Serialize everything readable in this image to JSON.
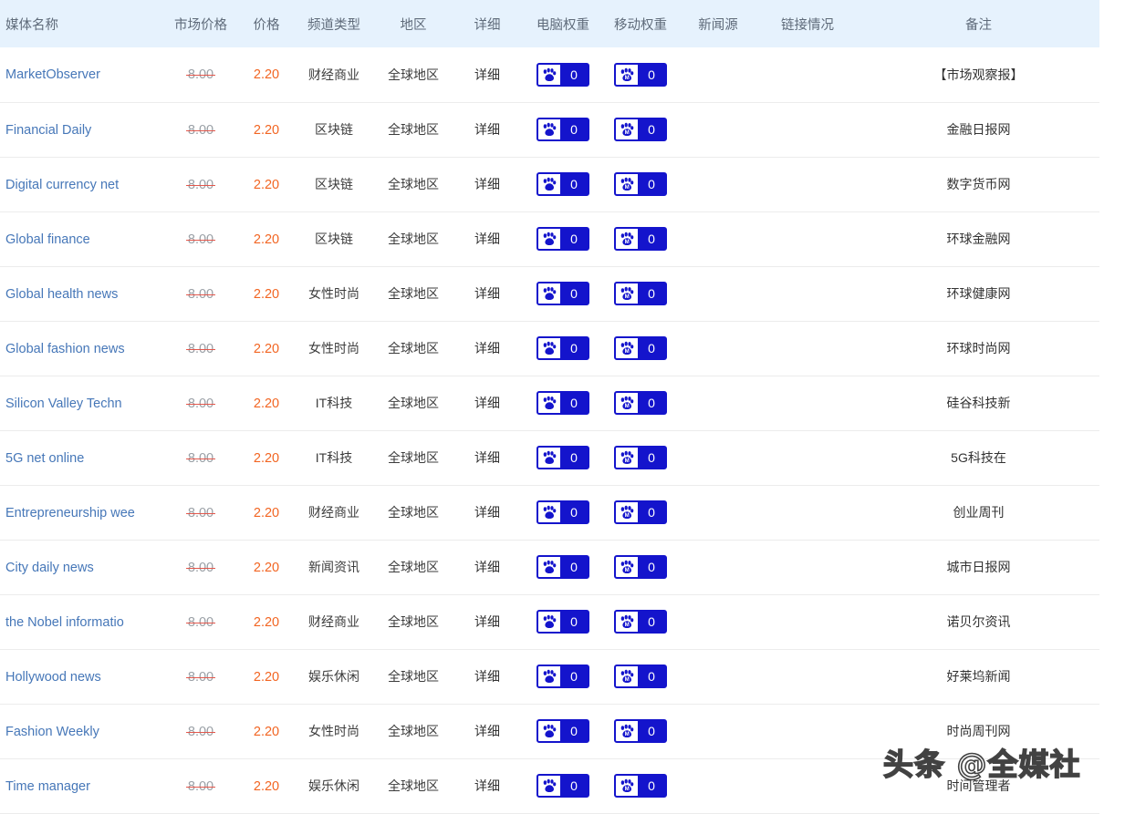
{
  "table": {
    "columns": [
      {
        "key": "name",
        "label": "媒体名称"
      },
      {
        "key": "market",
        "label": "市场价格"
      },
      {
        "key": "price",
        "label": "价格"
      },
      {
        "key": "channel",
        "label": "频道类型"
      },
      {
        "key": "region",
        "label": "地区"
      },
      {
        "key": "detail",
        "label": "详细"
      },
      {
        "key": "pc",
        "label": "电脑权重"
      },
      {
        "key": "mobile",
        "label": "移动权重"
      },
      {
        "key": "news",
        "label": "新闻源"
      },
      {
        "key": "link",
        "label": "链接情况"
      },
      {
        "key": "note",
        "label": "备注"
      }
    ],
    "detail_label": "详细",
    "rows": [
      {
        "name": "MarketObserver",
        "market": "8.00",
        "price": "2.20",
        "channel": "财经商业",
        "region": "全球地区",
        "detail": "详细",
        "pc": "0",
        "mobile": "0",
        "news": "",
        "link": "",
        "note": "【市场观察报】"
      },
      {
        "name": "Financial Daily",
        "market": "8.00",
        "price": "2.20",
        "channel": "区块链",
        "region": "全球地区",
        "detail": "详细",
        "pc": "0",
        "mobile": "0",
        "news": "",
        "link": "",
        "note": "金融日报网"
      },
      {
        "name": "Digital currency net",
        "market": "8.00",
        "price": "2.20",
        "channel": "区块链",
        "region": "全球地区",
        "detail": "详细",
        "pc": "0",
        "mobile": "0",
        "news": "",
        "link": "",
        "note": "数字货币网"
      },
      {
        "name": "Global finance",
        "market": "8.00",
        "price": "2.20",
        "channel": "区块链",
        "region": "全球地区",
        "detail": "详细",
        "pc": "0",
        "mobile": "0",
        "news": "",
        "link": "",
        "note": "环球金融网"
      },
      {
        "name": "Global health news",
        "market": "8.00",
        "price": "2.20",
        "channel": "女性时尚",
        "region": "全球地区",
        "detail": "详细",
        "pc": "0",
        "mobile": "0",
        "news": "",
        "link": "",
        "note": "环球健康网"
      },
      {
        "name": "Global fashion news",
        "market": "8.00",
        "price": "2.20",
        "channel": "女性时尚",
        "region": "全球地区",
        "detail": "详细",
        "pc": "0",
        "mobile": "0",
        "news": "",
        "link": "",
        "note": "环球时尚网"
      },
      {
        "name": "Silicon Valley Techn",
        "market": "8.00",
        "price": "2.20",
        "channel": "IT科技",
        "region": "全球地区",
        "detail": "详细",
        "pc": "0",
        "mobile": "0",
        "news": "",
        "link": "",
        "note": "硅谷科技新"
      },
      {
        "name": "5G net online",
        "market": "8.00",
        "price": "2.20",
        "channel": "IT科技",
        "region": "全球地区",
        "detail": "详细",
        "pc": "0",
        "mobile": "0",
        "news": "",
        "link": "",
        "note": "5G科技在"
      },
      {
        "name": "Entrepreneurship wee",
        "market": "8.00",
        "price": "2.20",
        "channel": "财经商业",
        "region": "全球地区",
        "detail": "详细",
        "pc": "0",
        "mobile": "0",
        "news": "",
        "link": "",
        "note": "创业周刊"
      },
      {
        "name": "City daily news",
        "market": "8.00",
        "price": "2.20",
        "channel": "新闻资讯",
        "region": "全球地区",
        "detail": "详细",
        "pc": "0",
        "mobile": "0",
        "news": "",
        "link": "",
        "note": "城市日报网"
      },
      {
        "name": "the Nobel informatio",
        "market": "8.00",
        "price": "2.20",
        "channel": "财经商业",
        "region": "全球地区",
        "detail": "详细",
        "pc": "0",
        "mobile": "0",
        "news": "",
        "link": "",
        "note": "诺贝尔资讯"
      },
      {
        "name": "Hollywood news",
        "market": "8.00",
        "price": "2.20",
        "channel": "娱乐休闲",
        "region": "全球地区",
        "detail": "详细",
        "pc": "0",
        "mobile": "0",
        "news": "",
        "link": "",
        "note": "好莱坞新闻"
      },
      {
        "name": "Fashion Weekly",
        "market": "8.00",
        "price": "2.20",
        "channel": "女性时尚",
        "region": "全球地区",
        "detail": "详细",
        "pc": "0",
        "mobile": "0",
        "news": "",
        "link": "",
        "note": "时尚周刊网"
      },
      {
        "name": "Time manager",
        "market": "8.00",
        "price": "2.20",
        "channel": "娱乐休闲",
        "region": "全球地区",
        "detail": "详细",
        "pc": "0",
        "mobile": "0",
        "news": "",
        "link": "",
        "note": "时间管理者"
      }
    ]
  },
  "watermark": {
    "text": "头条 @全媒社"
  },
  "icons": {
    "pc_weight": "baidu-paw-icon",
    "mobile_weight": "baidu-paw-mobile-icon"
  },
  "colors": {
    "header_bg": "#e6f2fd",
    "header_text": "#5f6b7a",
    "link": "#4677b8",
    "price": "#f26522",
    "market_strike": "#e2574c",
    "badge": "#1414cc",
    "row_divider": "#ececec"
  }
}
